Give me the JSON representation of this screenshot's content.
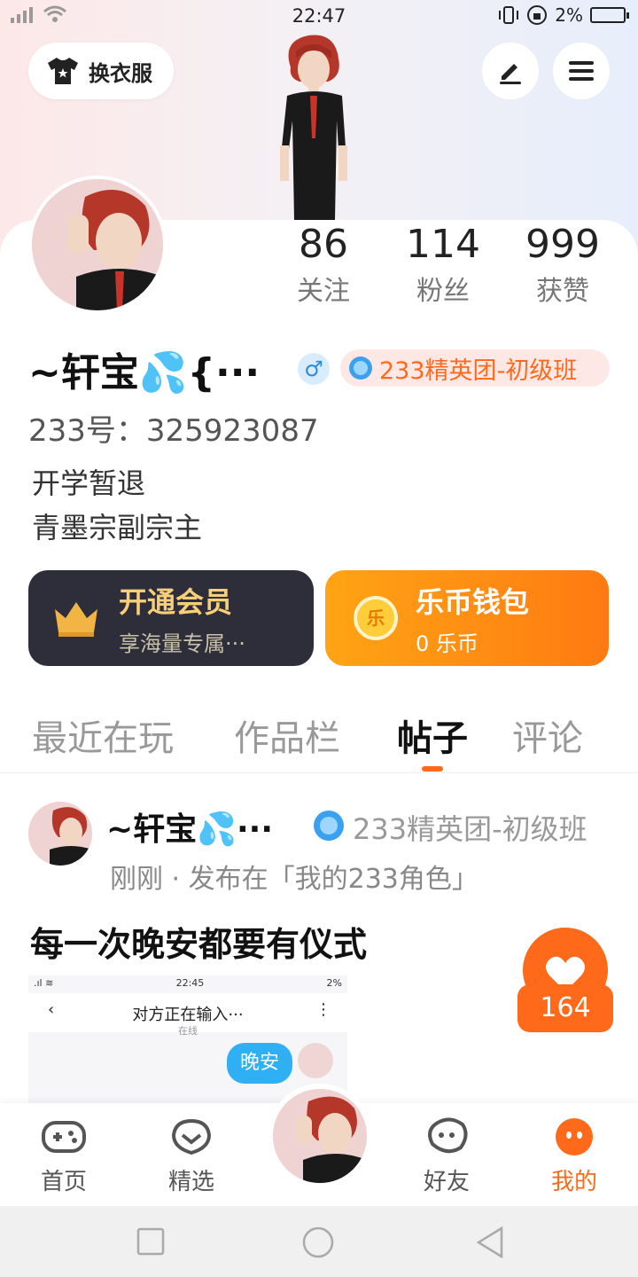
{
  "status_bar": {
    "time": "22:47",
    "battery": "2%"
  },
  "header": {
    "outfit_button": "换衣服"
  },
  "profile": {
    "stats": [
      {
        "value": "86",
        "label": "关注"
      },
      {
        "value": "114",
        "label": "粉丝"
      },
      {
        "value": "999",
        "label": "获赞"
      }
    ],
    "name": "~轩宝💦{···",
    "gender_symbol": "♂",
    "team_badge": "233精英团-初级班",
    "account_id": "233号：325923087",
    "bio_line1": "开学暂退",
    "bio_line2": "青墨宗副宗主"
  },
  "cards": {
    "vip_title": "开通会员",
    "vip_sub": "享海量专属···",
    "wallet_title": "乐币钱包",
    "wallet_balance": "0 乐币",
    "coin_glyph": "乐"
  },
  "tabs": [
    "最近在玩",
    "作品栏",
    "帖子",
    "评论"
  ],
  "post": {
    "author": "~轩宝💦···",
    "team": "233精英团-初级班",
    "meta": "刚刚 · 发布在「我的233角色」",
    "title": "每一次晚安都要有仪式",
    "likes": "164",
    "image": {
      "time": "22:45",
      "battery": "2%",
      "chat_title": "对方正在输入···",
      "chat_sub": "在线",
      "bubble": "晚安"
    }
  },
  "bottom_nav": [
    "首页",
    "精选",
    "好友",
    "我的"
  ],
  "colors": {
    "accent": "#ff6a1a",
    "vip_bg": "#2e2d3a",
    "vip_gold": "#f7cf78"
  }
}
